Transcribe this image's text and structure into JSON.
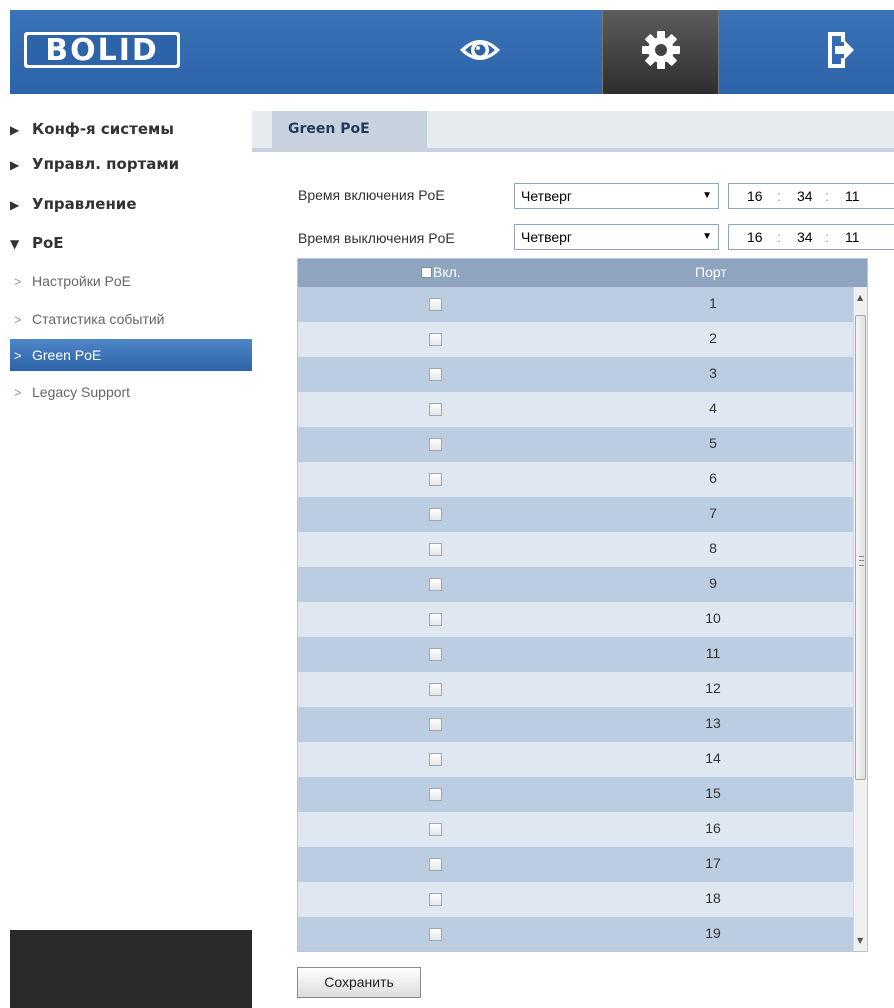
{
  "brand": {
    "logo_text": "BOLID"
  },
  "topnav": {
    "icons": [
      "eye-icon",
      "gear-icon",
      "exit-door-icon"
    ],
    "active": "settings"
  },
  "sidebar": {
    "sections": [
      {
        "label": "Конф-я системы",
        "expanded": false
      },
      {
        "label": "Управл. портами",
        "expanded": false
      },
      {
        "label": "Управление",
        "expanded": false
      },
      {
        "label": "PoE",
        "expanded": true
      }
    ],
    "poe_items": [
      {
        "label": "Настройки PoE"
      },
      {
        "label": "Статистика событий"
      },
      {
        "label": "Green PoE",
        "active": true
      },
      {
        "label": "Legacy Support"
      }
    ]
  },
  "main": {
    "tab_label": "Green PoE",
    "on_time": {
      "label": "Время включения PoE",
      "day": "Четверг",
      "hh": "16",
      "mm": "34",
      "ss": "11"
    },
    "off_time": {
      "label": "Время выключения PoE",
      "day": "Четверг",
      "hh": "16",
      "mm": "34",
      "ss": "11"
    },
    "table": {
      "col_enable": "Вкл.",
      "col_port": "Порт",
      "ports": [
        "1",
        "2",
        "3",
        "4",
        "5",
        "6",
        "7",
        "8",
        "9",
        "10",
        "11",
        "12",
        "13",
        "14",
        "15",
        "16",
        "17",
        "18",
        "19"
      ]
    },
    "save_label": "Сохранить"
  },
  "colors": {
    "header_blue": "#2d63a8",
    "row_odd": "#bccde2",
    "row_even": "#dfe7f1",
    "table_header": "#8fa4be"
  }
}
